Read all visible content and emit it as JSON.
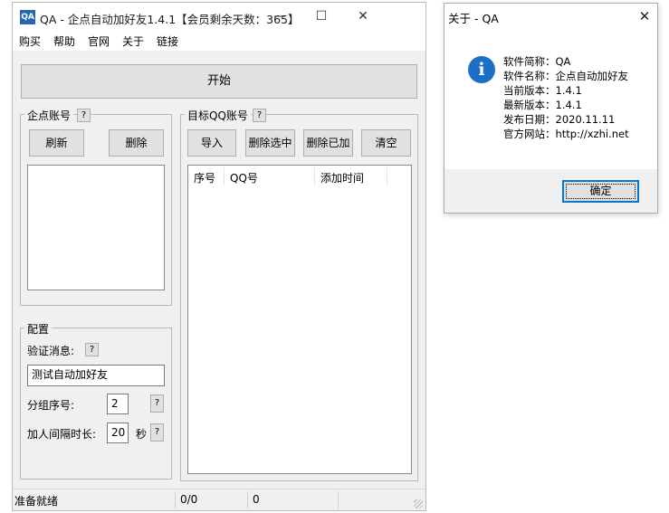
{
  "main": {
    "title": "QA - 企点自动加好友1.4.1【会员剩余天数：365】",
    "icon_text": "QA",
    "controls": {
      "minimize": "—",
      "maximize": "☐",
      "close": "✕"
    },
    "menu": [
      "购买",
      "帮助",
      "官网",
      "关于",
      "链接"
    ],
    "start_label": "开始",
    "enterprise_group": {
      "label": "企点账号",
      "help": "?",
      "refresh": "刷新",
      "delete": "删除"
    },
    "target_group": {
      "label": "目标QQ账号",
      "help": "?",
      "buttons": [
        "导入",
        "删除选中",
        "删除已加",
        "清空"
      ],
      "columns": [
        "序号",
        "QQ号",
        "添加时间"
      ]
    },
    "config": {
      "label": "配置",
      "verify_label": "验证消息:",
      "verify_help": "?",
      "verify_value": "测试自动加好友",
      "group_label": "分组序号:",
      "group_value": "2",
      "group_help": "?",
      "interval_label": "加人间隔时长:",
      "interval_value": "20",
      "interval_unit": "秒",
      "interval_help": "?"
    },
    "status": {
      "text": "准备就绪",
      "progress": "0/0",
      "count": "0"
    }
  },
  "about": {
    "title": "关于 - QA",
    "close": "✕",
    "icon_letter": "i",
    "lines": [
      "软件简称：QA",
      "软件名称：企点自动加好友",
      "当前版本：1.4.1",
      "最新版本：1.4.1",
      "发布日期：2020.11.11",
      "官方网站：http://xzhi.net"
    ],
    "ok_label": "确定"
  }
}
